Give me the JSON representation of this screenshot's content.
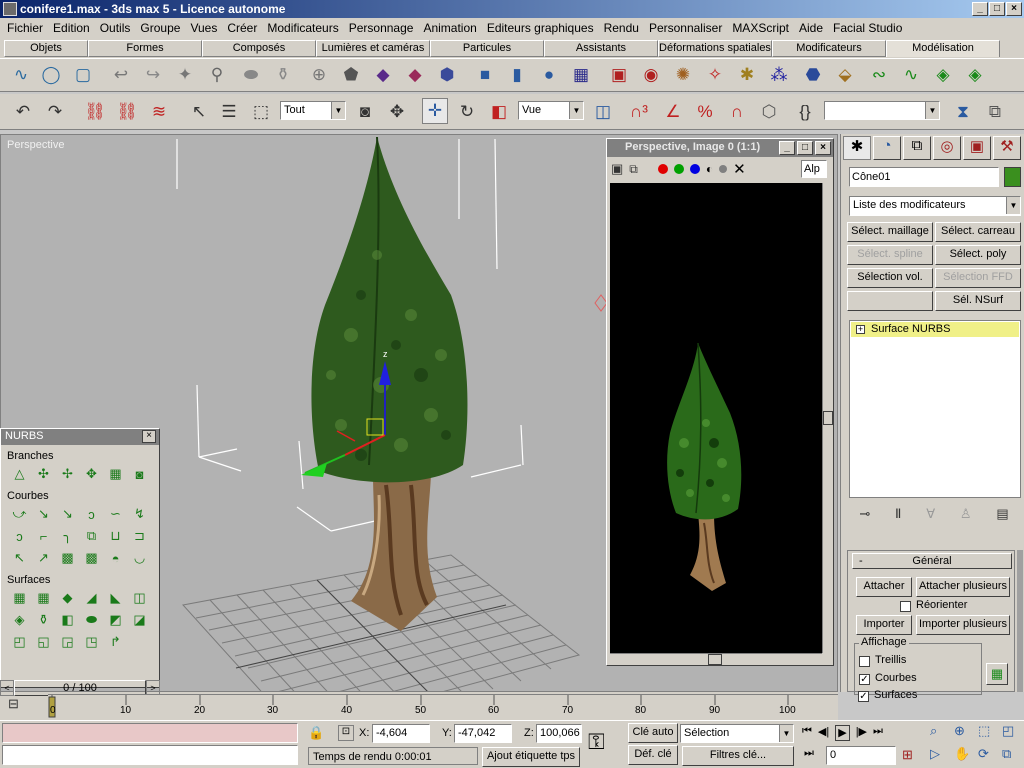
{
  "window": {
    "title": "conifere1.max - 3ds max 5 - Licence autonome",
    "buttons": [
      "_",
      "□",
      "×"
    ]
  },
  "menu": [
    "Fichier",
    "Edition",
    "Outils",
    "Groupe",
    "Vues",
    "Créer",
    "Modificateurs",
    "Personnage",
    "Animation",
    "Editeurs graphiques",
    "Rendu",
    "Personnaliser",
    "MAXScript",
    "Aide",
    "Facial Studio"
  ],
  "tabs": [
    "Objets",
    "Formes",
    "Composés",
    "Lumières et caméras",
    "Particules",
    "Assistants",
    "Déformations spatiales",
    "Modificateurs",
    "Modélisation"
  ],
  "active_tab": "Modélisation",
  "toolbar": {
    "selection_filter": "Tout",
    "coord_system": "Vue",
    "named_selection": ""
  },
  "viewport": {
    "label": "Perspective",
    "gizmo_axis_label": "z"
  },
  "nurbs_panel": {
    "title": "NURBS",
    "close": "×",
    "sections": [
      "Branches",
      "Courbes",
      "Surfaces"
    ]
  },
  "render_window": {
    "title": "Perspective, Image 0 (1:1)",
    "channel_label": "Alp",
    "channel_colors": [
      "#e00000",
      "#00a000",
      "#0000e0"
    ]
  },
  "command_panel": {
    "object_name": "Cône01",
    "object_color": "#3a8f1e",
    "modifier_list": "Liste des modificateurs",
    "buttons": {
      "select_mesh": "Sélect. maillage",
      "select_patch": "Sélect. carreau",
      "select_spline": "Sélect. spline",
      "select_poly": "Sélect. poly",
      "vol_select": "Sélection vol.",
      "select_ffd": "Sélection FFD",
      "select_nsurf": "Sél. NSurf"
    },
    "stack_item": "Surface NURBS",
    "stack_expand": "+",
    "rollout": {
      "title": "Général",
      "collapse": "-",
      "attach": "Attacher",
      "attach_multiple": "Attacher plusieurs",
      "reorient": "Réorienter",
      "import": "Importer",
      "import_multiple": "Importer plusieurs",
      "display_group": "Affichage",
      "lattices": "Treillis",
      "curves": "Courbes",
      "surfaces": "Surfaces"
    }
  },
  "timeline": {
    "frame_readout": "0 / 100",
    "ticks": [
      "0",
      "10",
      "20",
      "30",
      "40",
      "50",
      "60",
      "70",
      "80",
      "90",
      "100"
    ]
  },
  "status": {
    "x_label": "X:",
    "x_value": "-4,604",
    "y_label": "Y:",
    "y_value": "-47,042",
    "z_label": "Z:",
    "z_value": "100,066",
    "render_time": "Temps de rendu  0:00:01",
    "add_tag": "Ajout étiquette tps",
    "auto_key": "Clé auto",
    "set_key": "Déf. clé",
    "key_mode": "Sélection",
    "key_filters": "Filtres clé...",
    "current_frame": "0"
  }
}
